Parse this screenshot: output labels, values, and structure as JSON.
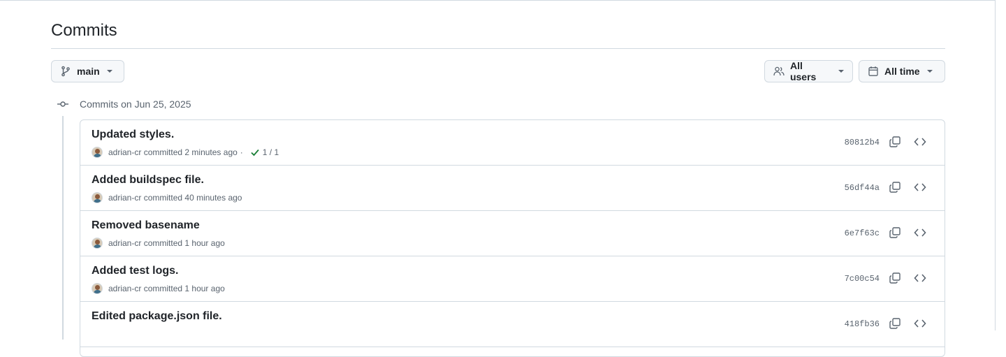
{
  "page": {
    "title": "Commits"
  },
  "filters": {
    "branch": {
      "label": "main",
      "icon": "git-branch-icon"
    },
    "users": {
      "label": "All users",
      "icon": "people-icon"
    },
    "time": {
      "label": "All time",
      "icon": "calendar-icon"
    }
  },
  "group": {
    "label": "Commits on Jun 25, 2025",
    "icon": "git-commit-icon"
  },
  "commits": [
    {
      "message": "Updated styles.",
      "author": "adrian-cr",
      "verb": "committed",
      "time": "2 minutes ago",
      "separator": "·",
      "checks": "1 / 1",
      "sha": "80812b4"
    },
    {
      "message": "Added buildspec file.",
      "author": "adrian-cr",
      "verb": "committed",
      "time": "40 minutes ago",
      "sha": "56df44a"
    },
    {
      "message": "Removed basename",
      "author": "adrian-cr",
      "verb": "committed",
      "time": "1 hour ago",
      "sha": "6e7f63c"
    },
    {
      "message": "Added test logs.",
      "author": "adrian-cr",
      "verb": "committed",
      "time": "1 hour ago",
      "sha": "7c00c54"
    },
    {
      "message": "Edited package.json file.",
      "sha": "418fb36"
    }
  ],
  "colors": {
    "success": "#1a7f37",
    "border": "#d1d9e0",
    "muted": "#59636e",
    "text": "#1f2328"
  }
}
